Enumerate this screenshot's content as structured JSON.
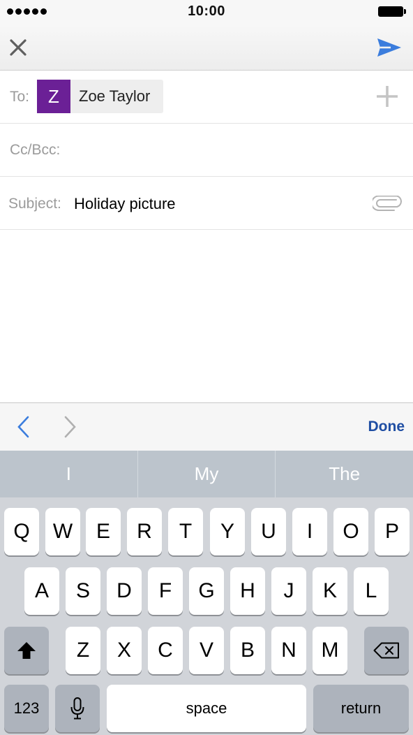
{
  "status_bar": {
    "time": "10:00",
    "signal_dots": 5
  },
  "nav": {
    "close_icon": "close-x-icon",
    "send_icon": "send-paper-plane-icon",
    "accent_color": "#3b7ddd"
  },
  "to": {
    "label": "To:",
    "recipient": {
      "initial": "Z",
      "name": "Zoe Taylor",
      "avatar_color": "#6b2096"
    },
    "add_icon": "plus-icon"
  },
  "cc": {
    "label": "Cc/Bcc:"
  },
  "subject": {
    "label": "Subject:",
    "value": "Holiday picture",
    "attach_icon": "paperclip-icon"
  },
  "accessory": {
    "prev_icon": "chevron-left-icon",
    "next_icon": "chevron-right-icon",
    "done_label": "Done"
  },
  "keyboard": {
    "suggestions": [
      "I",
      "My",
      "The"
    ],
    "row1": [
      "Q",
      "W",
      "E",
      "R",
      "T",
      "Y",
      "U",
      "I",
      "O",
      "P"
    ],
    "row2": [
      "A",
      "S",
      "D",
      "F",
      "G",
      "H",
      "J",
      "K",
      "L"
    ],
    "row3": [
      "Z",
      "X",
      "C",
      "V",
      "B",
      "N",
      "M"
    ],
    "numbers_label": "123",
    "space_label": "space",
    "return_label": "return",
    "shift_icon": "shift-arrow-icon",
    "delete_icon": "backspace-icon",
    "mic_icon": "microphone-icon"
  }
}
